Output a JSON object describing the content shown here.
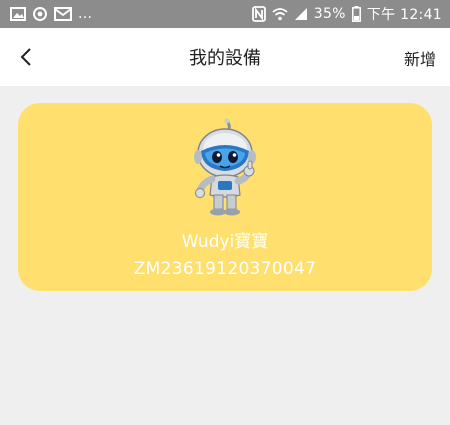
{
  "status_bar": {
    "left_overflow": "...",
    "battery": "35%",
    "time": "下午 12:41"
  },
  "header": {
    "title": "我的設備",
    "add_label": "新增"
  },
  "device": {
    "name": "Wudyi寶寶",
    "serial": "ZM23619120370047"
  },
  "colors": {
    "card": "#ffe06e",
    "status_bar": "#8c8c8c",
    "background": "#efefef"
  },
  "icons": [
    "image-icon",
    "power-icon",
    "mail-icon",
    "nfc-icon",
    "wifi-icon",
    "signal-icon",
    "battery-icon",
    "back-chevron-icon"
  ]
}
